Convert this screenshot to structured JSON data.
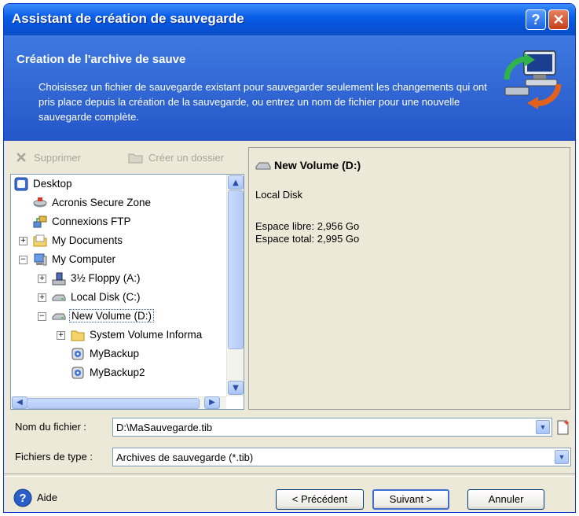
{
  "window": {
    "title": "Assistant de création de sauvegarde",
    "help_button": "?",
    "close_button": "✕"
  },
  "header": {
    "title": "Création de l'archive de sauve",
    "description": "Choisissez un fichier de sauvegarde existant pour sauvegarder seulement les changements qui ont pris place depuis la création de la sauvegarde, ou entrez un nom de fichier pour une nouvelle sauvegarde complète."
  },
  "toolbar": {
    "delete_label": "Supprimer",
    "create_folder_label": "Créer un dossier"
  },
  "tree": {
    "items": [
      {
        "label": "Desktop",
        "icon": "desktop-icon"
      },
      {
        "label": "Acronis Secure Zone",
        "icon": "secure-zone-icon"
      },
      {
        "label": "Connexions FTP",
        "icon": "ftp-icon"
      },
      {
        "label": "My Documents",
        "icon": "folder-icon"
      },
      {
        "label": "My Computer",
        "icon": "computer-icon"
      },
      {
        "label": "3½ Floppy (A:)",
        "icon": "floppy-icon"
      },
      {
        "label": "Local Disk (C:)",
        "icon": "drive-icon"
      },
      {
        "label": "New Volume (D:)",
        "icon": "drive-icon",
        "selected": true
      },
      {
        "label": "System Volume Informa",
        "icon": "folder-icon"
      },
      {
        "label": "MyBackup",
        "icon": "backup-file-icon"
      },
      {
        "label": "MyBackup2",
        "icon": "backup-file-icon"
      }
    ]
  },
  "info": {
    "title": "New Volume (D:)",
    "type": "Local Disk",
    "free_space": "Espace libre: 2,956 Go",
    "total_space": "Espace total: 2,995 Go"
  },
  "form": {
    "filename_label": "Nom du fichier :",
    "filename_value": "D:\\MaSauvegarde.tib",
    "filetype_label": "Fichiers de type :",
    "filetype_value": "Archives de sauvegarde (*.tib)"
  },
  "footer": {
    "help_label": "Aide",
    "back_label": "< Précédent",
    "next_label": "Suivant >",
    "cancel_label": "Annuler"
  },
  "colors": {
    "title_bar": "#0a5fe8",
    "header_bg": "#2d63d2",
    "window_bg": "#ece9d8",
    "selection_border": "#316ac5"
  }
}
